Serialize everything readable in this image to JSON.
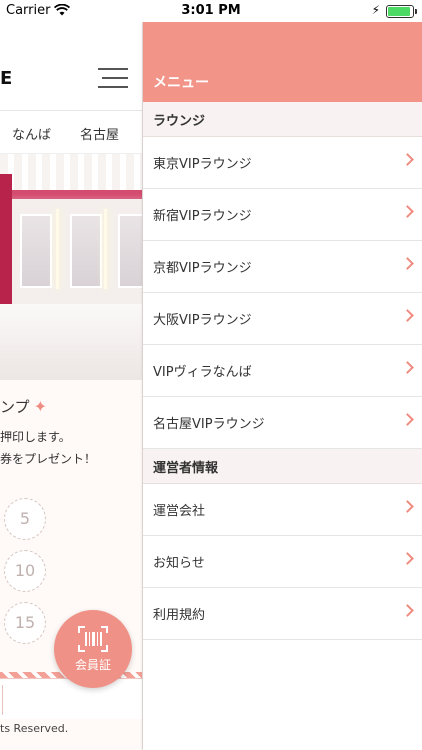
{
  "status_bar": {
    "carrier": "Carrier",
    "time": "3:01 PM"
  },
  "background_page": {
    "logo_fragment": "E",
    "tabs": [
      "なんば",
      "名古屋"
    ],
    "stamp_title": "ンプ",
    "stamp_desc_line1": "押印します。",
    "stamp_desc_line2": "券をプレゼント！",
    "stamp_numbers": [
      "5",
      "10",
      "15"
    ],
    "copyright": "ts Reserved.",
    "member_button_label": "会員証"
  },
  "drawer": {
    "title": "メニュー",
    "sections": [
      {
        "heading": "ラウンジ",
        "items": [
          "東京VIPラウンジ",
          "新宿VIPラウンジ",
          "京都VIPラウンジ",
          "大阪VIPラウンジ",
          "VIPヴィラなんば",
          "名古屋VIPラウンジ"
        ]
      },
      {
        "heading": "運営者情報",
        "items": [
          "運営会社",
          "お知らせ",
          "利用規約"
        ]
      }
    ]
  },
  "colors": {
    "accent": "#f29488",
    "chevron": "#ef8b80",
    "section_bg": "#f8f3f2"
  }
}
